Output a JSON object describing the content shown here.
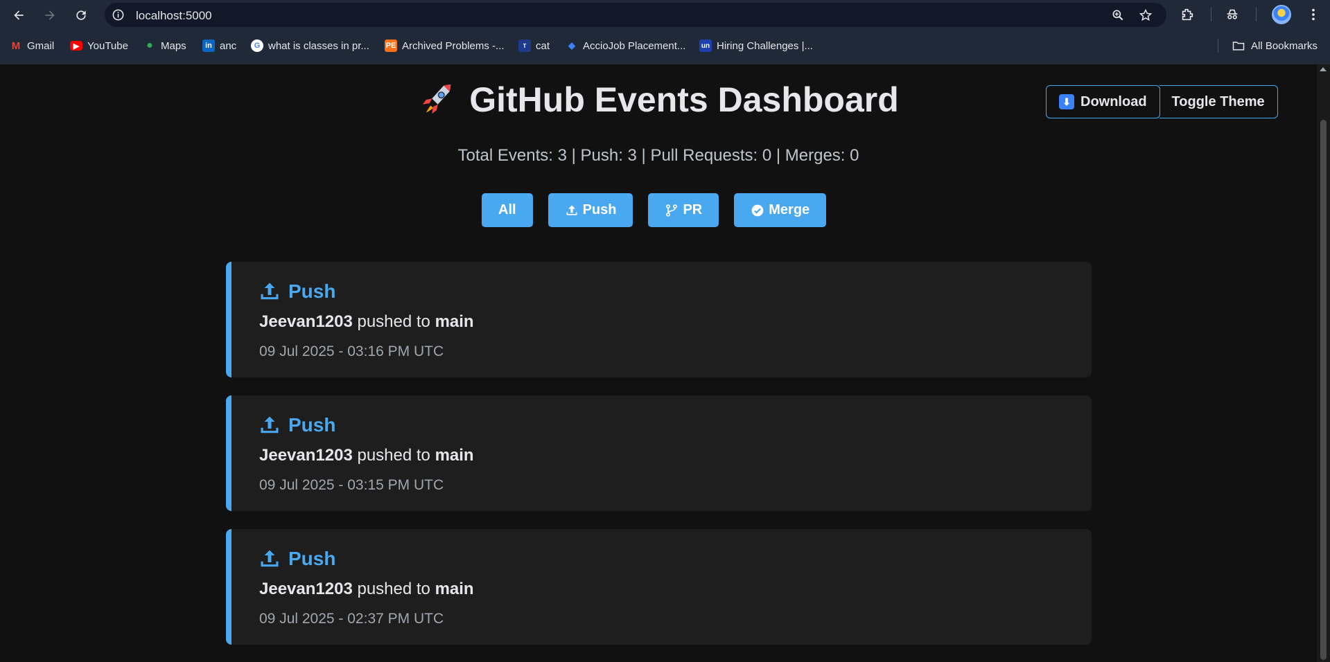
{
  "browser": {
    "url": "localhost:5000",
    "bookmarks": [
      {
        "label": "Gmail",
        "icon": "gmail-icon",
        "color": "#ea4335"
      },
      {
        "label": "YouTube",
        "icon": "youtube-icon",
        "color": "#ff0000"
      },
      {
        "label": "Maps",
        "icon": "maps-icon",
        "color": "#34a853"
      },
      {
        "label": "anc",
        "icon": "linkedin-icon",
        "color": "#0a66c2"
      },
      {
        "label": "what is classes in pr...",
        "icon": "google-icon",
        "color": "#ffffff"
      },
      {
        "label": "Archived Problems -...",
        "icon": "projecteuler-icon",
        "color": "#f97316"
      },
      {
        "label": "cat",
        "icon": "tata-icon",
        "color": "#1e3a8a"
      },
      {
        "label": "AccioJob Placement...",
        "icon": "acciojob-icon",
        "color": "#2563eb"
      },
      {
        "label": "Hiring Challenges |...",
        "icon": "unstop-icon",
        "color": "#1e40af"
      }
    ],
    "all_bookmarks_label": "All Bookmarks"
  },
  "header": {
    "title": "GitHub Events Dashboard",
    "download_label": "Download",
    "theme_label": "Toggle Theme"
  },
  "summary": "Total Events: 3 | Push: 3 | Pull Requests: 0 | Merges: 0",
  "filters": [
    {
      "label": "All",
      "icon": ""
    },
    {
      "label": "Push",
      "icon": "upload-icon"
    },
    {
      "label": "PR",
      "icon": "branch-icon"
    },
    {
      "label": "Merge",
      "icon": "check-circle-icon"
    }
  ],
  "events": [
    {
      "type": "Push",
      "author": "Jeevan1203",
      "verb": "pushed to",
      "branch": "main",
      "time": "09 Jul 2025 - 03:16 PM UTC"
    },
    {
      "type": "Push",
      "author": "Jeevan1203",
      "verb": "pushed to",
      "branch": "main",
      "time": "09 Jul 2025 - 03:15 PM UTC"
    },
    {
      "type": "Push",
      "author": "Jeevan1203",
      "verb": "pushed to",
      "branch": "main",
      "time": "09 Jul 2025 - 02:37 PM UTC"
    }
  ],
  "colors": {
    "accent": "#4aa8f0",
    "background": "#111111",
    "card": "#1e1e1e",
    "chrome": "#1f2937"
  }
}
